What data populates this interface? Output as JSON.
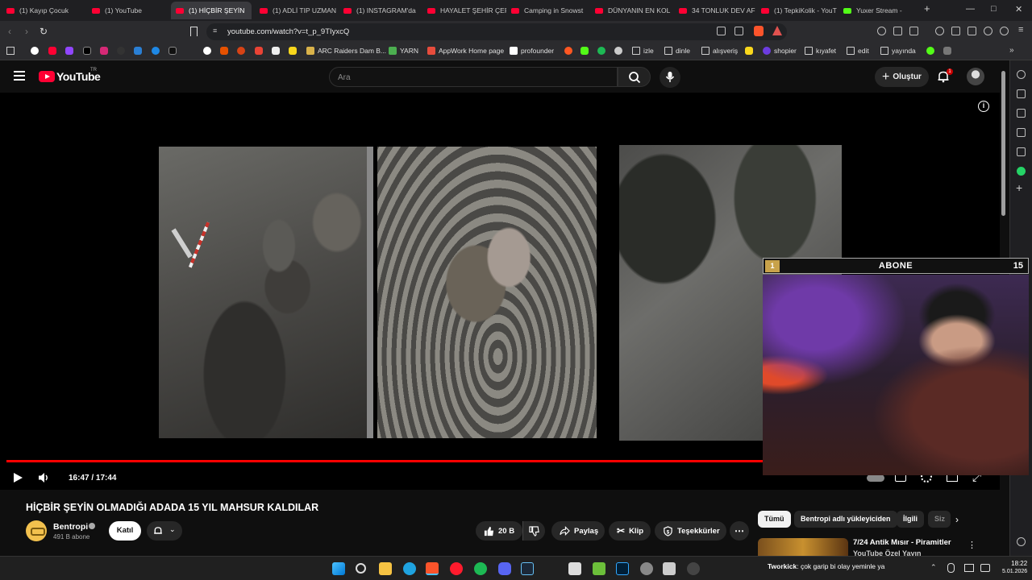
{
  "tabs": [
    {
      "label": "(1) Kayıp Çocuk",
      "active": false
    },
    {
      "label": "(1) YouTube",
      "active": false
    },
    {
      "label": "(1) HİÇBİR ŞEYİN",
      "active": true
    },
    {
      "label": "(1) ADLİ TIP UZMAN",
      "active": false
    },
    {
      "label": "(1) INSTAGRAM'da",
      "active": false
    },
    {
      "label": "HAYALET ŞEHİR ÇER",
      "active": false
    },
    {
      "label": "Camping in Snowst",
      "active": false
    },
    {
      "label": "DÜNYANIN EN KOL",
      "active": false
    },
    {
      "label": "34 TONLUK DEV AF",
      "active": false
    },
    {
      "label": "(1) TepkiKolik - YouT",
      "active": false
    },
    {
      "label": "Yuxer Stream -",
      "active": false
    }
  ],
  "tab_close_glyph": "×",
  "new_tab_glyph": "+",
  "address": {
    "url": "youtube.com/watch?v=t_p_9TIyxcQ"
  },
  "bookmarks": [
    {
      "label": "ARC Raiders Dam B...",
      "color": "#d9b24a"
    },
    {
      "label": "YARN",
      "color": "#4caf50"
    },
    {
      "label": "AppWork Home page",
      "color": "#e74c3c"
    },
    {
      "label": "profounder",
      "color": "#ffffff"
    },
    {
      "label": "izle",
      "color": "#cfcfcf"
    },
    {
      "label": "dinle",
      "color": "#cfcfcf"
    },
    {
      "label": "alışveriş",
      "color": "#cfcfcf"
    },
    {
      "label": "shopier",
      "color": "#6c3ce0"
    },
    {
      "label": "kıyafet",
      "color": "#cfcfcf"
    },
    {
      "label": "edit",
      "color": "#cfcfcf"
    },
    {
      "label": "yayında",
      "color": "#cfcfcf"
    }
  ],
  "youtube": {
    "logo_text": "YouTube",
    "country": "TR",
    "search_placeholder": "Ara",
    "create_label": "Oluştur",
    "notif_count": "1"
  },
  "player": {
    "time": "16:47 / 17:44",
    "progress": 0.9465
  },
  "overlay": {
    "left_badge": "1",
    "title": "ABONE",
    "right_count": "15"
  },
  "video": {
    "title": "HİÇBİR ŞEYİN OLMADIĞI ADADA 15 YIL MAHSUR KALDILAR",
    "channel": "Bentropi",
    "subs": "491 B abone",
    "join_label": "Katıl",
    "likes": "20 B",
    "share_label": "Paylaş",
    "clip_label": "Klip",
    "thanks_label": "Teşekkürler"
  },
  "chips": [
    "Tümü",
    "Bentropi adlı yükleyiciden",
    "İlgili",
    "Siz"
  ],
  "suggestion": {
    "title": "7/24 Antik Mısır - Piramitler",
    "subtitle": "YouTube Özel Yayın"
  },
  "taskbar": {
    "time": "18:22",
    "date": "5.01.2026",
    "chat_user": "Tworkick",
    "chat_message": ": çok garip bi olay yeminle ya"
  }
}
